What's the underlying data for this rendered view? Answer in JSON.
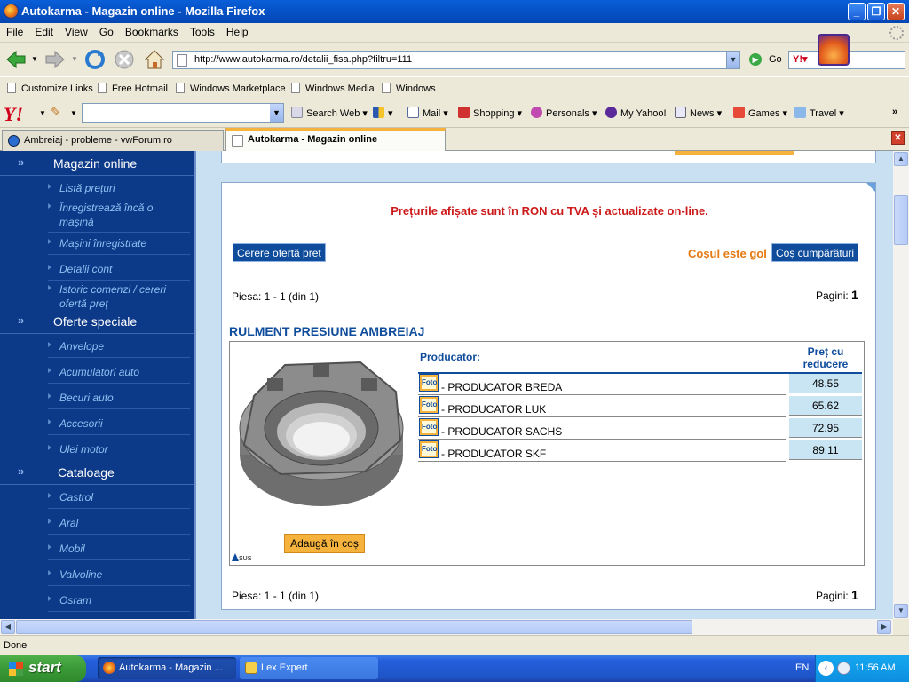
{
  "window": {
    "title": "Autokarma - Magazin online - Mozilla Firefox"
  },
  "menu": [
    "File",
    "Edit",
    "View",
    "Go",
    "Bookmarks",
    "Tools",
    "Help"
  ],
  "nav": {
    "url": "http://www.autokarma.ro/detalii_fisa.php?filtru=111",
    "go_label": "Go"
  },
  "links": [
    "Customize Links",
    "Free Hotmail",
    "Windows Marketplace",
    "Windows Media",
    "Windows"
  ],
  "yahoo": {
    "search_web": "Search Web",
    "mail": "Mail",
    "shopping": "Shopping",
    "personals": "Personals",
    "my_yahoo": "My Yahoo!",
    "news": "News",
    "games": "Games",
    "travel": "Travel"
  },
  "tabs": [
    {
      "label": "Ambreiaj - probleme - vwForum.ro"
    },
    {
      "label": "Autokarma - Magazin online"
    }
  ],
  "sidebar": {
    "sections": [
      {
        "title": "Magazin online"
      },
      {
        "title": "Oferte speciale"
      },
      {
        "title": "Cataloage"
      }
    ],
    "shop_items": [
      "Listă prețuri",
      "Înregistrează încă o mașină",
      "Mașini înregistrate",
      "Detalii cont",
      "Istoric comenzi / cereri ofertă preț"
    ],
    "offer_items": [
      "Anvelope",
      "Acumulatori auto",
      "Becuri auto",
      "Accesorii",
      "Ulei motor"
    ],
    "catalog_items": [
      "Castrol",
      "Aral",
      "Mobil",
      "Valvoline",
      "Osram"
    ]
  },
  "main": {
    "notice": "Prețurile afișate sunt în RON cu TVA și actualizate on-line.",
    "request_offer": "Cerere ofertă preț",
    "cart_empty": "Coșul este gol",
    "cart_button": "Coș cumpărături",
    "piece_label": "Piesa: 1 - 1 (din 1)",
    "pages_label": "Pagini:",
    "pages_value": "1",
    "product_title": "RULMENT PRESIUNE AMBREIAJ",
    "producer_header": "Producator:",
    "price_header": "Preț cu reducere",
    "foto_label": "Foto",
    "add_to_cart": "Adaugă în coș",
    "sus": "SUS",
    "producers": [
      {
        "name": "- PRODUCATOR BREDA",
        "price": "48.55"
      },
      {
        "name": "- PRODUCATOR LUK",
        "price": "65.62"
      },
      {
        "name": "- PRODUCATOR SACHS",
        "price": "72.95"
      },
      {
        "name": "- PRODUCATOR SKF",
        "price": "89.11"
      }
    ]
  },
  "status": {
    "text": "Done"
  },
  "taskbar": {
    "start": "start",
    "tasks": [
      "Autokarma - Magazin ...",
      "Lex Expert"
    ],
    "lang": "EN",
    "clock": "11:56 AM"
  }
}
